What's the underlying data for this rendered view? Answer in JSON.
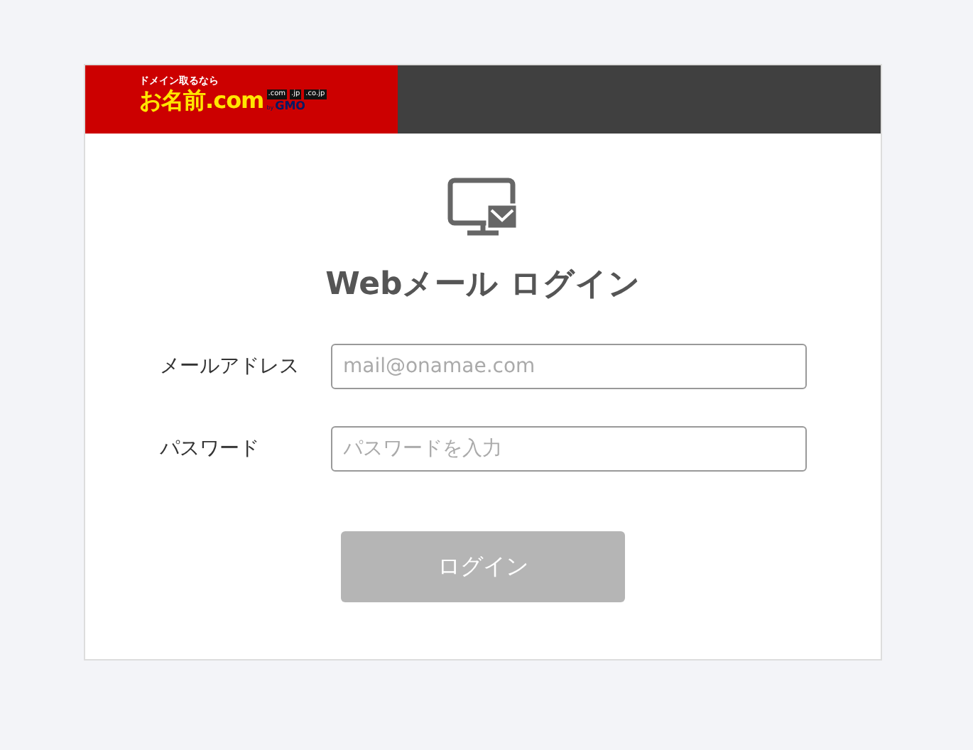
{
  "logo": {
    "tagline": "ドメイン取るなら",
    "name": "お名前.com",
    "domains": [
      ".com",
      ".jp",
      ".co.jp"
    ],
    "by": "by",
    "brand": "GMO"
  },
  "title": "Webメール ログイン",
  "fields": [
    {
      "label": "メールアドレス",
      "placeholder": "mail@onamae.com"
    },
    {
      "label": "パスワード",
      "placeholder": "パスワードを入力"
    }
  ],
  "login_button": {
    "label": "ログイン",
    "disabled": true
  }
}
